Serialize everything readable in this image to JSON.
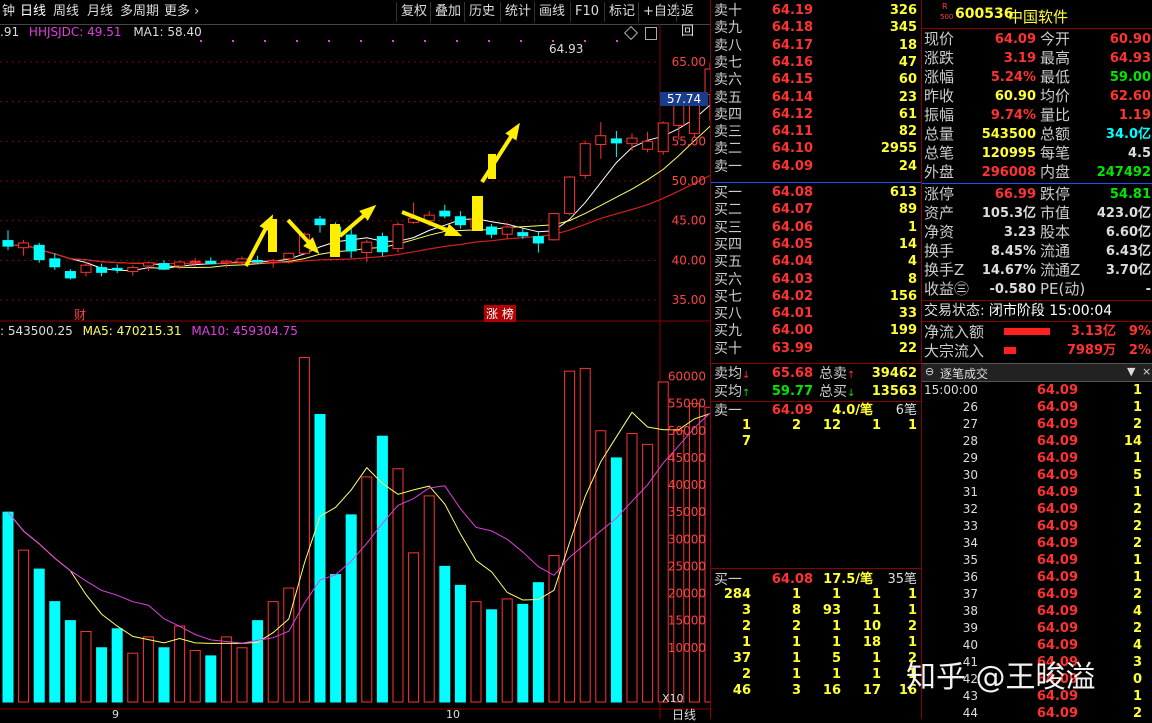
{
  "toolbar": {
    "left_items": [
      "钟",
      "日线",
      "周线",
      "月线",
      "多周期",
      "更多"
    ],
    "right_items": [
      "复权",
      "叠加",
      "历史",
      "统计",
      "画线",
      "F10",
      "标记",
      "+自选",
      "返回"
    ]
  },
  "price_legend": {
    "ind1": ".91",
    "ind2": "HHJSJDC: 49.51",
    "ind3": "MA1: 58.40"
  },
  "volume_legend": {
    "vol": ": 543500.25",
    "ma5": "MA5: 470215.31",
    "ma10": "MA10: 459304.75"
  },
  "price_chart": {
    "y_ticks": [
      "65.00",
      "60.00",
      "55.00",
      "50.00",
      "45.00",
      "40.00",
      "35.00"
    ],
    "current_value_label": "57.74",
    "high_label": "64.93",
    "markers": [
      "财",
      "涨",
      "榜"
    ]
  },
  "volume_chart": {
    "y_ticks": [
      "60000",
      "55000",
      "50000",
      "45000",
      "40000",
      "35000",
      "30000",
      "25000",
      "20000",
      "15000",
      "10000"
    ],
    "unit": "X10",
    "x_labels": [
      "9",
      "10"
    ],
    "period": "日线"
  },
  "chart_data": {
    "type": "candlestick",
    "price_range": [
      32.5,
      67.5
    ],
    "volume_range": [
      0,
      66000
    ],
    "candles": [
      {
        "o": 42.5,
        "h": 43.8,
        "l": 41.3,
        "c": 41.8,
        "v": 35000
      },
      {
        "o": 41.6,
        "h": 42.6,
        "l": 40.6,
        "c": 42.2,
        "v": 28000
      },
      {
        "o": 41.9,
        "h": 42.2,
        "l": 39.7,
        "c": 40.1,
        "v": 24500
      },
      {
        "o": 40.2,
        "h": 40.9,
        "l": 38.8,
        "c": 39.2,
        "v": 18500
      },
      {
        "o": 38.6,
        "h": 38.9,
        "l": 37.6,
        "c": 37.8,
        "v": 15000
      },
      {
        "o": 38.5,
        "h": 39.8,
        "l": 38.0,
        "c": 39.4,
        "v": 13000
      },
      {
        "o": 39.1,
        "h": 39.6,
        "l": 38.0,
        "c": 38.5,
        "v": 10000
      },
      {
        "o": 39.0,
        "h": 39.5,
        "l": 38.4,
        "c": 38.8,
        "v": 13500
      },
      {
        "o": 38.6,
        "h": 39.4,
        "l": 38.1,
        "c": 39.1,
        "v": 9000
      },
      {
        "o": 39.3,
        "h": 39.9,
        "l": 38.7,
        "c": 39.7,
        "v": 12000
      },
      {
        "o": 39.6,
        "h": 40.0,
        "l": 38.8,
        "c": 38.9,
        "v": 10000
      },
      {
        "o": 39.3,
        "h": 40.0,
        "l": 38.9,
        "c": 39.8,
        "v": 14000
      },
      {
        "o": 39.8,
        "h": 40.3,
        "l": 39.2,
        "c": 39.9,
        "v": 9500
      },
      {
        "o": 39.9,
        "h": 40.4,
        "l": 39.5,
        "c": 39.6,
        "v": 8500
      },
      {
        "o": 39.7,
        "h": 40.1,
        "l": 39.1,
        "c": 39.9,
        "v": 12000
      },
      {
        "o": 39.8,
        "h": 40.5,
        "l": 39.5,
        "c": 40.2,
        "v": 10000
      },
      {
        "o": 40.0,
        "h": 40.6,
        "l": 39.6,
        "c": 39.8,
        "v": 15000
      },
      {
        "o": 39.8,
        "h": 40.2,
        "l": 39.1,
        "c": 40.0,
        "v": 18500
      },
      {
        "o": 40.2,
        "h": 41.0,
        "l": 39.6,
        "c": 40.9,
        "v": 21000
      },
      {
        "o": 40.9,
        "h": 43.5,
        "l": 40.7,
        "c": 43.3,
        "v": 63500
      },
      {
        "o": 45.2,
        "h": 45.6,
        "l": 43.5,
        "c": 44.5,
        "v": 53000
      },
      {
        "o": 44.2,
        "h": 44.8,
        "l": 42.0,
        "c": 43.0,
        "v": 23500
      },
      {
        "o": 43.2,
        "h": 44.2,
        "l": 40.3,
        "c": 41.2,
        "v": 34500
      },
      {
        "o": 41.0,
        "h": 42.6,
        "l": 39.8,
        "c": 42.3,
        "v": 41500
      },
      {
        "o": 43.0,
        "h": 43.5,
        "l": 40.5,
        "c": 41.1,
        "v": 49000
      },
      {
        "o": 41.5,
        "h": 44.8,
        "l": 41.0,
        "c": 44.5,
        "v": 43000
      },
      {
        "o": 44.8,
        "h": 47.3,
        "l": 44.6,
        "c": 45.3,
        "v": 27500
      },
      {
        "o": 45.0,
        "h": 46.2,
        "l": 44.3,
        "c": 45.7,
        "v": 38000
      },
      {
        "o": 46.2,
        "h": 47.0,
        "l": 45.3,
        "c": 45.6,
        "v": 25000
      },
      {
        "o": 45.5,
        "h": 46.2,
        "l": 44.0,
        "c": 44.5,
        "v": 21500
      },
      {
        "o": 44.2,
        "h": 45.8,
        "l": 43.7,
        "c": 45.2,
        "v": 18500
      },
      {
        "o": 44.2,
        "h": 44.6,
        "l": 42.8,
        "c": 43.3,
        "v": 17000
      },
      {
        "o": 43.3,
        "h": 44.8,
        "l": 42.7,
        "c": 44.2,
        "v": 19000
      },
      {
        "o": 43.5,
        "h": 44.0,
        "l": 42.7,
        "c": 43.1,
        "v": 18000
      },
      {
        "o": 43.0,
        "h": 43.6,
        "l": 41.0,
        "c": 42.2,
        "v": 22000
      },
      {
        "o": 42.6,
        "h": 46.0,
        "l": 42.5,
        "c": 45.9,
        "v": 27000
      },
      {
        "o": 45.9,
        "h": 50.6,
        "l": 45.7,
        "c": 50.5,
        "v": 61000
      },
      {
        "o": 50.7,
        "h": 55.1,
        "l": 50.3,
        "c": 54.7,
        "v": 61500
      },
      {
        "o": 54.6,
        "h": 57.4,
        "l": 52.8,
        "c": 55.7,
        "v": 50000
      },
      {
        "o": 55.3,
        "h": 56.3,
        "l": 53.0,
        "c": 54.8,
        "v": 45000
      },
      {
        "o": 54.7,
        "h": 56.0,
        "l": 53.8,
        "c": 55.4,
        "v": 49500
      },
      {
        "o": 54.0,
        "h": 56.2,
        "l": 53.6,
        "c": 55.0,
        "v": 47500
      },
      {
        "o": 53.7,
        "h": 57.5,
        "l": 53.3,
        "c": 57.3,
        "v": 59000
      },
      {
        "o": 57.0,
        "h": 61.0,
        "l": 55.2,
        "c": 60.5,
        "v": 50000
      },
      {
        "o": 56.0,
        "h": 61.2,
        "l": 55.5,
        "c": 60.9,
        "v": 55000
      },
      {
        "o": 60.9,
        "h": 64.9,
        "l": 57.6,
        "c": 64.1,
        "v": 54350
      }
    ]
  },
  "order_book": {
    "asks": [
      {
        "label": "卖十",
        "price": "64.19",
        "vol": "326"
      },
      {
        "label": "卖九",
        "price": "64.18",
        "vol": "345"
      },
      {
        "label": "卖八",
        "price": "64.17",
        "vol": "18"
      },
      {
        "label": "卖七",
        "price": "64.16",
        "vol": "47"
      },
      {
        "label": "卖六",
        "price": "64.15",
        "vol": "60"
      },
      {
        "label": "卖五",
        "price": "64.14",
        "vol": "23"
      },
      {
        "label": "卖四",
        "price": "64.12",
        "vol": "61"
      },
      {
        "label": "卖三",
        "price": "64.11",
        "vol": "82"
      },
      {
        "label": "卖二",
        "price": "64.10",
        "vol": "2955"
      },
      {
        "label": "卖一",
        "price": "64.09",
        "vol": "24"
      }
    ],
    "bids": [
      {
        "label": "买一",
        "price": "64.08",
        "vol": "613"
      },
      {
        "label": "买二",
        "price": "64.07",
        "vol": "89"
      },
      {
        "label": "买三",
        "price": "64.06",
        "vol": "1"
      },
      {
        "label": "买四",
        "price": "64.05",
        "vol": "14"
      },
      {
        "label": "买五",
        "price": "64.04",
        "vol": "4"
      },
      {
        "label": "买六",
        "price": "64.03",
        "vol": "8"
      },
      {
        "label": "买七",
        "price": "64.02",
        "vol": "156"
      },
      {
        "label": "买八",
        "price": "64.01",
        "vol": "33"
      },
      {
        "label": "买九",
        "price": "64.00",
        "vol": "199"
      },
      {
        "label": "买十",
        "price": "63.99",
        "vol": "22"
      }
    ],
    "ask_avg": {
      "label": "卖均",
      "price": "65.68",
      "total_label": "总卖",
      "total": "39462"
    },
    "bid_avg": {
      "label": "买均",
      "price": "59.77",
      "total_label": "总买",
      "total": "13563"
    },
    "ask1_queue": {
      "label": "卖一",
      "price": "64.09",
      "per": "4.0/笔",
      "count": "6笔",
      "rows": [
        [
          "1",
          "2",
          "12",
          "1",
          "1"
        ],
        [
          "7",
          "",
          "",
          "",
          ""
        ]
      ]
    },
    "bid1_queue": {
      "label": "买一",
      "price": "64.08",
      "per": "17.5/笔",
      "count": "35笔",
      "rows": [
        [
          "284",
          "1",
          "1",
          "1",
          "1"
        ],
        [
          "3",
          "8",
          "93",
          "1",
          "1"
        ],
        [
          "2",
          "2",
          "1",
          "10",
          "2"
        ],
        [
          "1",
          "1",
          "1",
          "18",
          "1"
        ],
        [
          "37",
          "1",
          "5",
          "1",
          "2"
        ],
        [
          "2",
          "1",
          "1",
          "1",
          "1"
        ],
        [
          "46",
          "3",
          "16",
          "17",
          "16"
        ]
      ]
    }
  },
  "quote": {
    "code": "600536",
    "name": "中国软件",
    "badge_top": "R",
    "badge_bottom": "500",
    "fields": [
      [
        "现价",
        "64.09",
        "今开",
        "60.90"
      ],
      [
        "涨跌",
        "3.19",
        "最高",
        "64.93"
      ],
      [
        "涨幅",
        "5.24%",
        "最低",
        "59.00"
      ],
      [
        "昨收",
        "60.90",
        "均价",
        "62.60"
      ],
      [
        "振幅",
        "9.74%",
        "量比",
        "1.19"
      ],
      [
        "总量",
        "543500",
        "总额",
        "34.0亿"
      ],
      [
        "总笔",
        "120995",
        "每笔",
        "4.5"
      ],
      [
        "外盘",
        "296008",
        "内盘",
        "247492"
      ]
    ],
    "fields2": [
      [
        "涨停",
        "66.99",
        "跌停",
        "54.81"
      ],
      [
        "资产",
        "105.3亿",
        "市值",
        "423.0亿"
      ],
      [
        "净资",
        "3.23",
        "股本",
        "6.60亿"
      ],
      [
        "换手",
        "8.45%",
        "流通",
        "6.43亿"
      ],
      [
        "换手Z",
        "14.67%",
        "流通Z",
        "3.70亿"
      ],
      [
        "收益㊂",
        "-0.580",
        "PE(动)",
        "-"
      ]
    ],
    "status_label": "交易状态:",
    "status_value": "闭市阶段 15:00:04",
    "net_inflow_label": "净流入额",
    "net_inflow_value": "3.13亿",
    "net_inflow_pct": "9%",
    "block_inflow_label": "大宗流入",
    "block_inflow_value": "7989万",
    "block_inflow_pct": "2%"
  },
  "ticks": {
    "title": "逐笔成交",
    "first_time": "15:00:00",
    "rows": [
      {
        "idx": "",
        "price": "64.09",
        "vol": "1"
      },
      {
        "idx": "26",
        "price": "64.09",
        "vol": "1"
      },
      {
        "idx": "27",
        "price": "64.09",
        "vol": "2"
      },
      {
        "idx": "28",
        "price": "64.09",
        "vol": "14"
      },
      {
        "idx": "29",
        "price": "64.09",
        "vol": "1"
      },
      {
        "idx": "30",
        "price": "64.09",
        "vol": "5"
      },
      {
        "idx": "31",
        "price": "64.09",
        "vol": "1"
      },
      {
        "idx": "32",
        "price": "64.09",
        "vol": "2"
      },
      {
        "idx": "33",
        "price": "64.09",
        "vol": "2"
      },
      {
        "idx": "34",
        "price": "64.09",
        "vol": "2"
      },
      {
        "idx": "35",
        "price": "64.09",
        "vol": "1"
      },
      {
        "idx": "36",
        "price": "64.09",
        "vol": "1"
      },
      {
        "idx": "37",
        "price": "64.09",
        "vol": "2"
      },
      {
        "idx": "38",
        "price": "64.09",
        "vol": "4"
      },
      {
        "idx": "39",
        "price": "64.09",
        "vol": "2"
      },
      {
        "idx": "40",
        "price": "64.09",
        "vol": "4"
      },
      {
        "idx": "41",
        "price": "64.09",
        "vol": "3"
      },
      {
        "idx": "42",
        "price": "64.09",
        "vol": "0"
      },
      {
        "idx": "43",
        "price": "64.09",
        "vol": "1"
      },
      {
        "idx": "44",
        "price": "64.09",
        "vol": "2"
      }
    ]
  },
  "watermark": "知乎 @王晙溢",
  "colors": {
    "up": "#ff3333",
    "down": "#00ffff",
    "ma_yellow": "#ffff66",
    "ma_purple": "#e040e0",
    "ma_red": "#d02020",
    "grid": "#8a0000",
    "arrow": "#ffee00"
  }
}
